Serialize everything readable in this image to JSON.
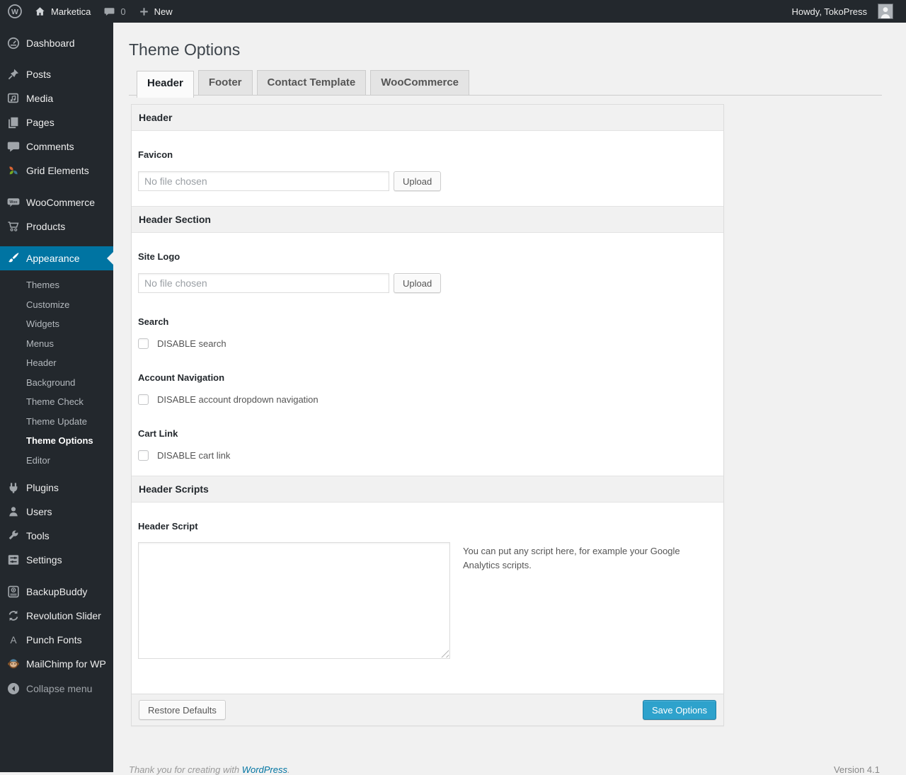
{
  "admin_bar": {
    "site_name": "Marketica",
    "comment_count": "0",
    "new_label": "New",
    "howdy": "Howdy, TokoPress"
  },
  "sidebar": {
    "main": [
      "Dashboard",
      "Posts",
      "Media",
      "Pages",
      "Comments",
      "Grid Elements",
      "WooCommerce",
      "Products",
      "Appearance",
      "Plugins",
      "Users",
      "Tools",
      "Settings",
      "BackupBuddy",
      "Revolution Slider",
      "Punch Fonts",
      "MailChimp for WP"
    ],
    "appearance_submenu": [
      "Themes",
      "Customize",
      "Widgets",
      "Menus",
      "Header",
      "Background",
      "Theme Check",
      "Theme Update",
      "Theme Options",
      "Editor"
    ],
    "current_item": "Appearance",
    "current_subitem": "Theme Options",
    "collapse": "Collapse menu"
  },
  "page": {
    "title": "Theme Options",
    "tabs": [
      "Header",
      "Footer",
      "Contact Template",
      "WooCommerce"
    ],
    "active_tab": "Header"
  },
  "panel": {
    "header_title": "Header",
    "favicon": {
      "label": "Favicon",
      "placeholder": "No file chosen",
      "upload": "Upload"
    },
    "header_section_title": "Header Section",
    "site_logo": {
      "label": "Site Logo",
      "placeholder": "No file chosen",
      "upload": "Upload"
    },
    "search": {
      "label": "Search",
      "checkbox_label": "DISABLE search",
      "checked": false
    },
    "account_nav": {
      "label": "Account Navigation",
      "checkbox_label": "DISABLE account dropdown navigation",
      "checked": false
    },
    "cart_link": {
      "label": "Cart Link",
      "checkbox_label": "DISABLE cart link",
      "checked": false
    },
    "header_scripts_title": "Header Scripts",
    "header_script": {
      "label": "Header Script",
      "value": "",
      "help": "You can put any script here, for example your Google Analytics scripts."
    },
    "restore_button": "Restore Defaults",
    "save_button": "Save Options"
  },
  "footer": {
    "thanks": "Thank you for creating with",
    "wordpress_link": "WordPress",
    "suffix": ".",
    "version": "Version 4.1"
  },
  "colors": {
    "menu_highlight": "#0074a2",
    "primary_button": "#2ea2cc",
    "link": "#0074a2",
    "admin_bg": "#23282d",
    "page_bg": "#f1f1f1"
  }
}
